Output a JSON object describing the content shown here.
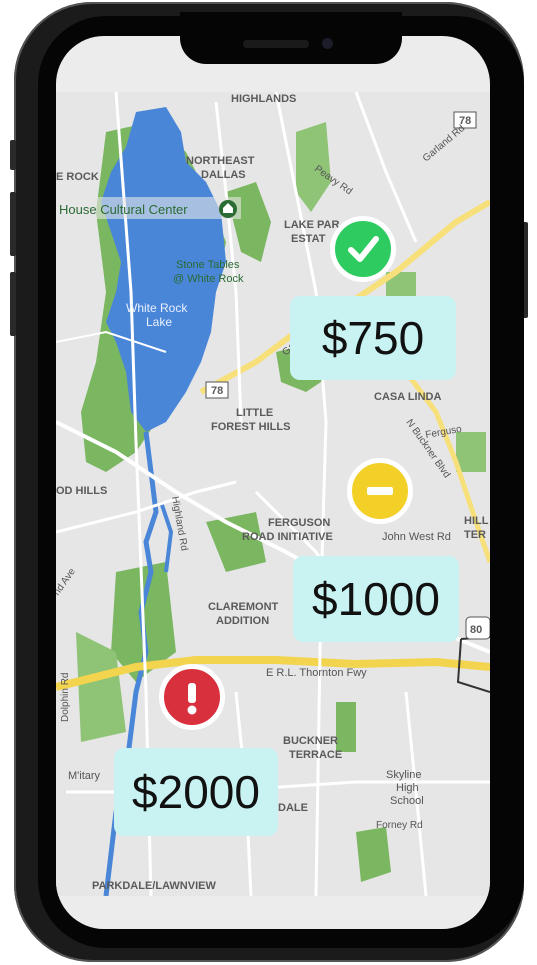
{
  "map": {
    "labels": {
      "highlands": "HIGHLANDS",
      "route78_top": "78",
      "rock": "E ROCK",
      "northeast": "NORTHEAST",
      "dallas": "DALLAS",
      "house_cultural": "House Cultural Center",
      "stone_tables_1": "Stone Tables",
      "stone_tables_2": "@ White Rock",
      "white_rock_1": "White Rock",
      "white_rock_2": "Lake",
      "lake_par": "LAKE PAR",
      "estat": "ESTAT",
      "route78_mid": "78",
      "little": "LITTLE",
      "forest_hills": "FOREST HILLS",
      "casa_linda": "CASA LINDA",
      "od_hills": "OD HILLS",
      "ferguson": "FERGUSON",
      "road_initiative": "ROAD INITIATIVE",
      "john_west_rd": "John West Rd",
      "hill": "HILL",
      "ter": "TER",
      "claremont": "CLAREMONT",
      "addition": "ADDITION",
      "route80": "80",
      "erl_thornton": "E R.L. Thornton Fwy",
      "buckner": "BUCKNER",
      "terrace": "TERRACE",
      "skyline_1": "Skyline",
      "skyline_2": "High",
      "skyline_3": "School",
      "forney_rd": "Forney Rd",
      "dale": "DALE",
      "military": "M'itary",
      "dolphin_rd": "Dolphin Rd",
      "parkdale": "PARKDALE/LAWNVIEW",
      "garland_rd": "Garland Rd",
      "peavy_rd": "Peavy Rd",
      "ferguson_rd": "Ferguso",
      "n_buckner_blvd": "N Buckner Blvd",
      "highland_rd": "Highland Rd",
      "ave": "nd Ave"
    },
    "colors": {
      "lake": "#4a86d8",
      "park": "#7bb661",
      "road": "#f7e07a",
      "base": "#e6e6e6"
    }
  },
  "markers": [
    {
      "status": "ok",
      "icon": "check-icon",
      "color": "#2ecc60",
      "price": "$750"
    },
    {
      "status": "warning",
      "icon": "minus-icon",
      "color": "#f2d028",
      "price": "$1000"
    },
    {
      "status": "alert",
      "icon": "exclamation-icon",
      "color": "#d8303c",
      "price": "$2000"
    }
  ]
}
